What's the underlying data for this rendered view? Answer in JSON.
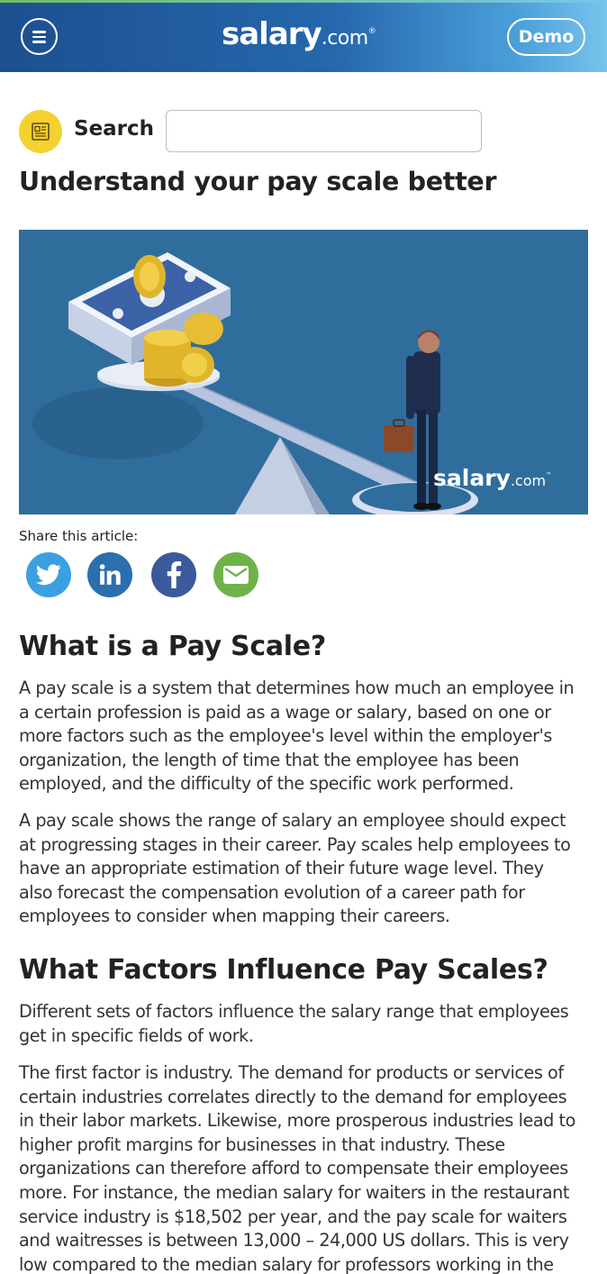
{
  "header": {
    "logo_main": "salary",
    "logo_com": ".com",
    "logo_reg": "®",
    "demo_label": "Demo"
  },
  "search": {
    "label": "Search",
    "value": "",
    "placeholder": ""
  },
  "page_title": "Understand your pay scale better",
  "hero": {
    "watermark_main": "salary",
    "watermark_com": ".com",
    "watermark_tm": "™"
  },
  "share": {
    "label": "Share this article:",
    "icons": [
      "twitter-icon",
      "linkedin-icon",
      "facebook-icon",
      "email-icon"
    ],
    "colors": {
      "twitter": "#3ba0e1",
      "linkedin": "#2c6fad",
      "facebook": "#3b5a9b",
      "email": "#6fb24a"
    }
  },
  "sections": [
    {
      "heading": "What is a Pay Scale?",
      "paragraphs": [
        "A pay scale is a system that determines how much an employee in a certain profession is paid as a wage or salary, based on one or more factors such as the employee's level within the employer's organization, the length of time that the employee has been employed, and the difficulty of the specific work performed.",
        "A pay scale shows the range of salary an employee should expect at progressing stages in their career. Pay scales help employees to have an appropriate estimation of their future wage level. They also forecast the compensation evolution of a career path for employees to consider when mapping their careers."
      ]
    },
    {
      "heading": "What Factors Influence Pay Scales?",
      "paragraphs": [
        "Different sets of factors influence the salary range that employees get in specific fields of work.",
        "The first factor is industry. The demand for products or services of certain industries correlates directly to the demand for employees in their labor markets. Likewise, more prosperous industries lead to higher profit margins for businesses in that industry. These organizations can therefore afford to compensate their employees more. For instance, the median salary for waiters in the restaurant service industry is $18,502 per year, and the pay scale for waiters and waitresses is between 13,000 – 24,000 US dollars. This is very low compared to the median salary for professors working in the"
      ]
    }
  ],
  "colors": {
    "header_start": "#1d4f8f",
    "header_end": "#77c4ec",
    "search_badge": "#f5d130",
    "hero_bg": "#2f6e9c"
  }
}
